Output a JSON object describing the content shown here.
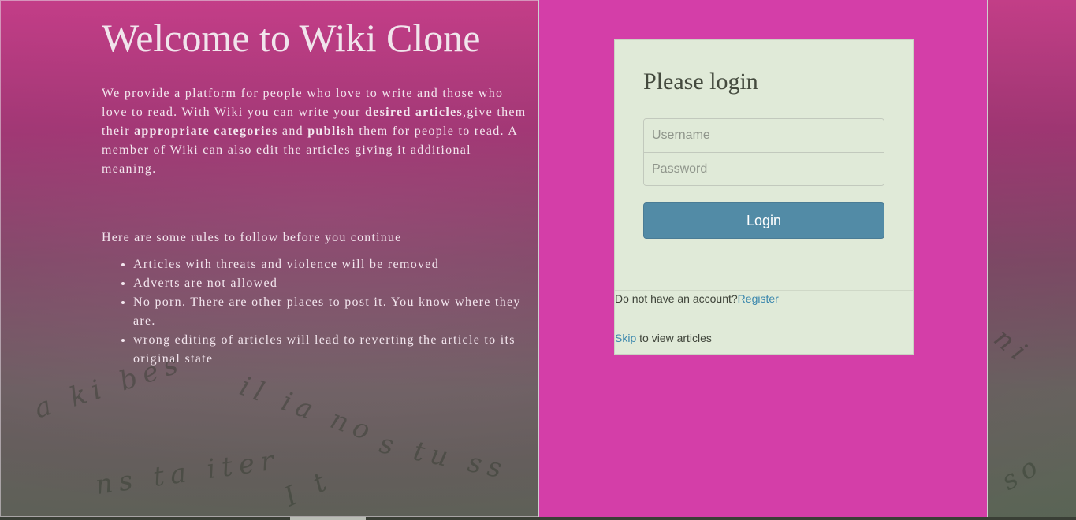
{
  "left": {
    "title": "Welcome to Wiki Clone",
    "intro": {
      "part1": "We provide a platform for people who love to write and those who love to read. With Wiki you can write your ",
      "bold1": "desired articles",
      "part2": ",give them their ",
      "bold2": "appropriate categories",
      "part3": " and ",
      "bold3": "publish",
      "part4": " them for people to read. A member of Wiki can also edit the articles giving it additional meaning."
    },
    "rules_intro": "Here are some rules to follow before you continue",
    "rules": [
      "Articles with threats and violence will be removed",
      "Adverts are not allowed",
      "No porn. There are other places to post it. You know where they are.",
      "wrong editing of articles will lead to reverting the article to its original state"
    ]
  },
  "login": {
    "title": "Please login",
    "username_placeholder": "Username",
    "password_placeholder": "Password",
    "button_label": "Login",
    "register_prompt": "Do not have an account?",
    "register_link": "Register",
    "skip_link": "Skip",
    "skip_suffix": " to view articles"
  },
  "colors": {
    "right_panel_bg": "#d43ea8",
    "card_bg": "#e0ead8",
    "button_bg": "#528ba6",
    "link": "#3a87ad"
  }
}
